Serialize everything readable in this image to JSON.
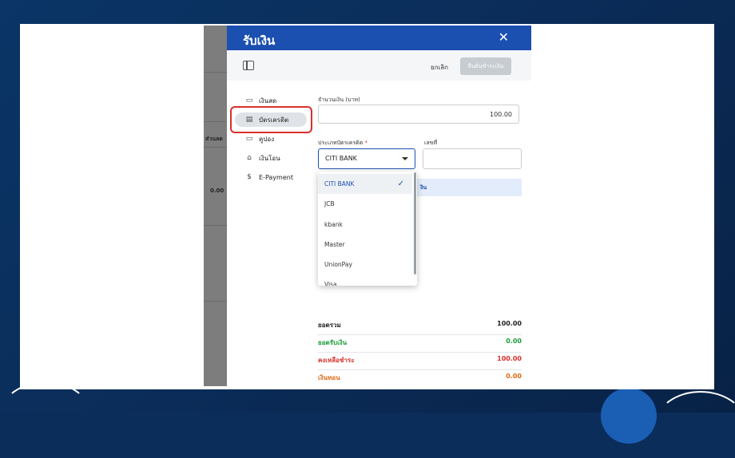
{
  "modal": {
    "title": "รับเงิน",
    "close_glyph": "✕",
    "toolbar": {
      "cancel_label": "ยกเลิก",
      "confirm_label": "ยืนยันชำระเงิน"
    }
  },
  "background_app": {
    "column_label": "ส่วนลด",
    "value": "0.00"
  },
  "payment_methods": [
    {
      "label": "เงินสด",
      "icon": "cash-icon"
    },
    {
      "label": "บัตรเครดิต",
      "icon": "credit-card-icon",
      "active": true
    },
    {
      "label": "คูปอง",
      "icon": "coupon-icon"
    },
    {
      "label": "เงินโอน",
      "icon": "bank-icon"
    },
    {
      "label": "E-Payment",
      "icon": "e-payment-icon"
    }
  ],
  "form": {
    "amount_label": "จำนวนเงิน (บาท)",
    "amount_value": "100.00",
    "card_type_label": "ประเภทบัตรเครดิต",
    "required_mark": "*",
    "card_type_value": "CITI BANK",
    "number_label": "เลขที่",
    "info_text": "งิน"
  },
  "dropdown": {
    "options": [
      "CITI BANK",
      "JCB",
      "kbank",
      "Master",
      "UnionPay",
      "Visa"
    ],
    "selected": "CITI BANK"
  },
  "summary": [
    {
      "label": "ยอดรวม",
      "value": "100.00",
      "color": "#222222"
    },
    {
      "label": "ยอดรับเงิน",
      "value": "0.00",
      "color": "#1a9c3a"
    },
    {
      "label": "คงเหลือชำระ",
      "value": "100.00",
      "color": "#d9302c"
    },
    {
      "label": "เงินทอน",
      "value": "0.00",
      "color": "#e06a12"
    }
  ],
  "colors": {
    "primary": "#1b4fb0",
    "highlight": "#d9302c"
  }
}
